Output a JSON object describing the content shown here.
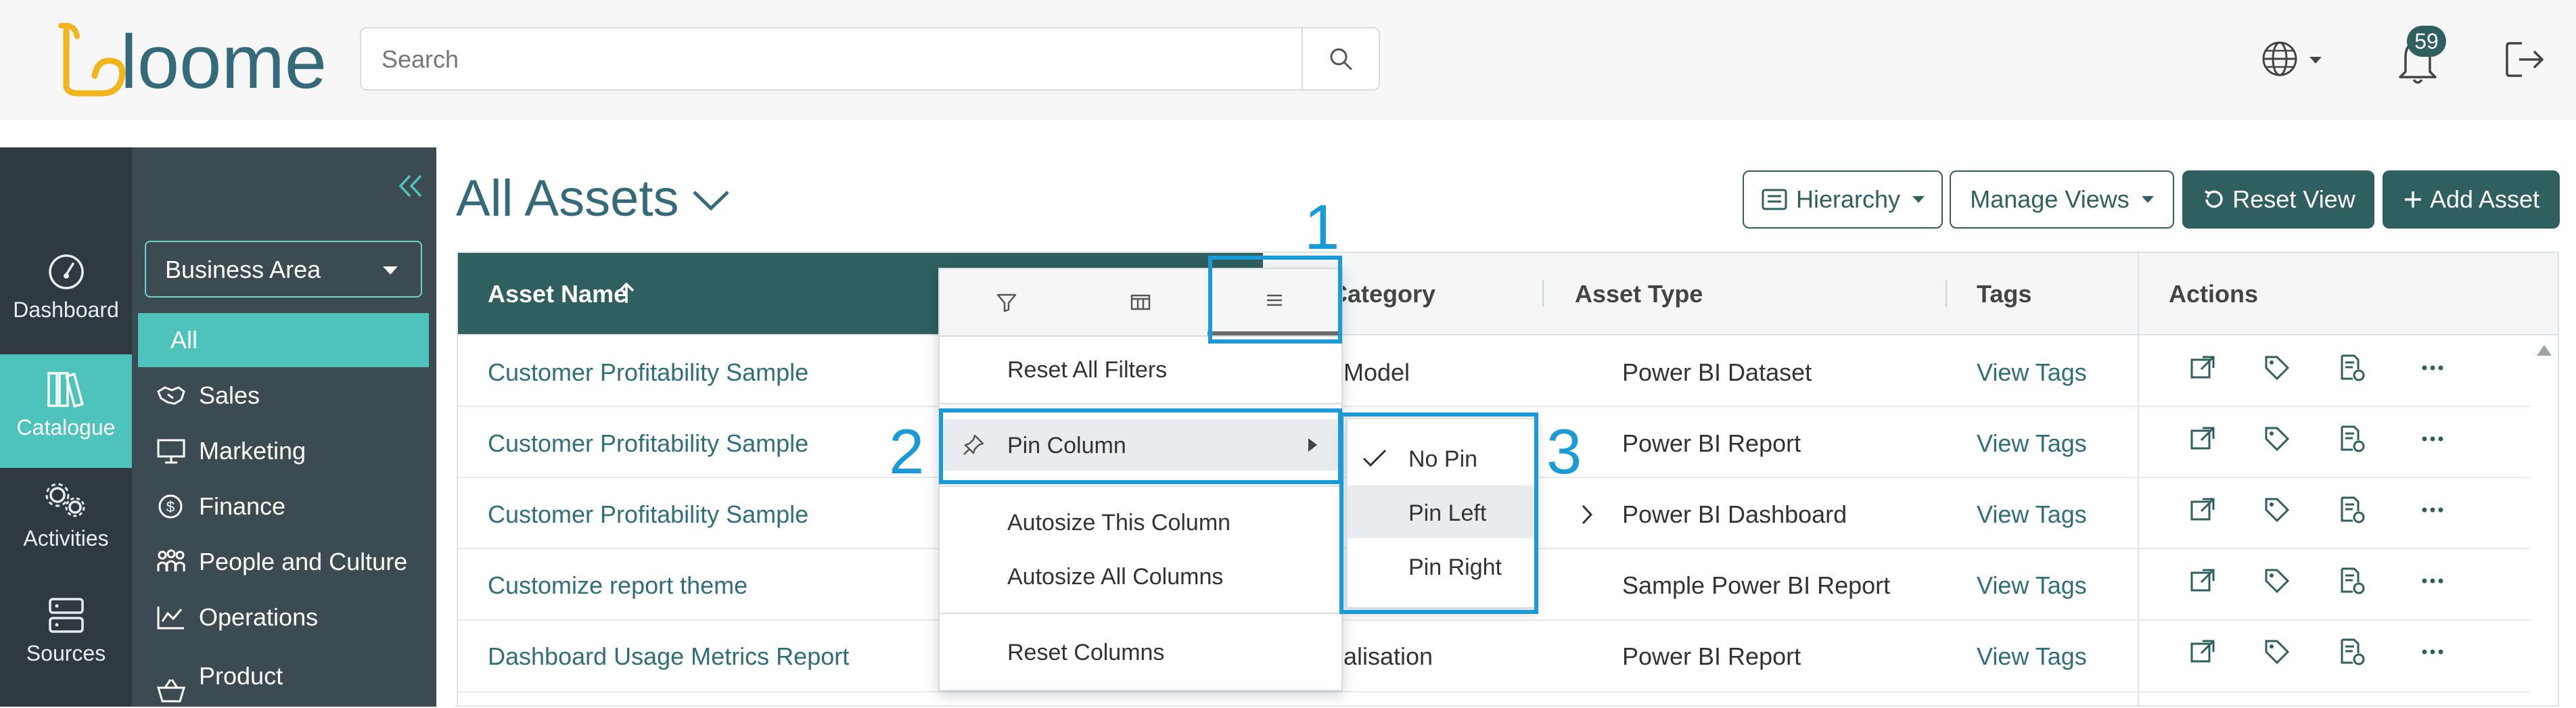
{
  "header": {
    "logo_text": "loome",
    "search": {
      "placeholder": "Search",
      "value": ""
    },
    "notifications_count": "59"
  },
  "rail": [
    {
      "label": "Dashboard",
      "icon": "dashboard-gauge-icon",
      "active": false
    },
    {
      "label": "Catalogue",
      "icon": "books-icon",
      "active": true
    },
    {
      "label": "Activities",
      "icon": "gears-icon",
      "active": false
    },
    {
      "label": "Sources",
      "icon": "server-icon",
      "active": false
    }
  ],
  "sidebar": {
    "selector_value": "Business Area",
    "items": [
      {
        "label": "All",
        "icon": "",
        "active": true
      },
      {
        "label": "Sales",
        "icon": "handshake-icon"
      },
      {
        "label": "Marketing",
        "icon": "presentation-icon"
      },
      {
        "label": "Finance",
        "icon": "dollar-circle-icon"
      },
      {
        "label": "People and Culture",
        "icon": "people-icon"
      },
      {
        "label": "Operations",
        "icon": "chart-icon"
      },
      {
        "label": "Product",
        "icon": "basket-icon"
      }
    ]
  },
  "main": {
    "title": "All Assets",
    "toolbar": {
      "hierarchy_label": "Hierarchy",
      "manage_views_label": "Manage Views",
      "reset_view_label": "Reset View",
      "add_asset_label": "Add Asset"
    },
    "columns": {
      "asset_name": "Asset Name",
      "category": "Category",
      "asset_type": "Asset Type",
      "tags": "Tags",
      "actions": "Actions"
    },
    "rows": [
      {
        "name": "Customer Profitability Sample",
        "category": "Model",
        "type": "Power BI Dataset",
        "tags": "View Tags"
      },
      {
        "name": "Customer Profitability Sample",
        "category": "",
        "type": "Power BI Report",
        "tags": "View Tags"
      },
      {
        "name": "Customer Profitability Sample",
        "category": "",
        "type": "Power BI Dashboard",
        "tags": "View Tags"
      },
      {
        "name": "Customize report theme",
        "category": "",
        "type": "Sample Power BI Report",
        "tags": "View Tags"
      },
      {
        "name": "Dashboard Usage Metrics Report",
        "category": "alisation",
        "type": "Power BI Report",
        "tags": "View Tags"
      }
    ]
  },
  "column_menu": {
    "tabs": [
      "filter-icon",
      "columns-icon",
      "menu-icon"
    ],
    "items": {
      "reset_filters": "Reset All Filters",
      "pin_column": "Pin Column",
      "autosize_this": "Autosize This Column",
      "autosize_all": "Autosize All Columns",
      "reset_columns": "Reset Columns"
    },
    "pin_submenu": {
      "no_pin": "No Pin",
      "pin_left": "Pin Left",
      "pin_right": "Pin Right",
      "selected": "No Pin"
    }
  },
  "callouts": [
    "1",
    "2",
    "3"
  ],
  "colors": {
    "accent_teal": "#4ec3bb",
    "dark_teal": "#2f5f5f",
    "rail_bg": "#2e3a3f",
    "sidebar_bg": "#3c4b51",
    "callout_blue": "#1a9ad6"
  }
}
